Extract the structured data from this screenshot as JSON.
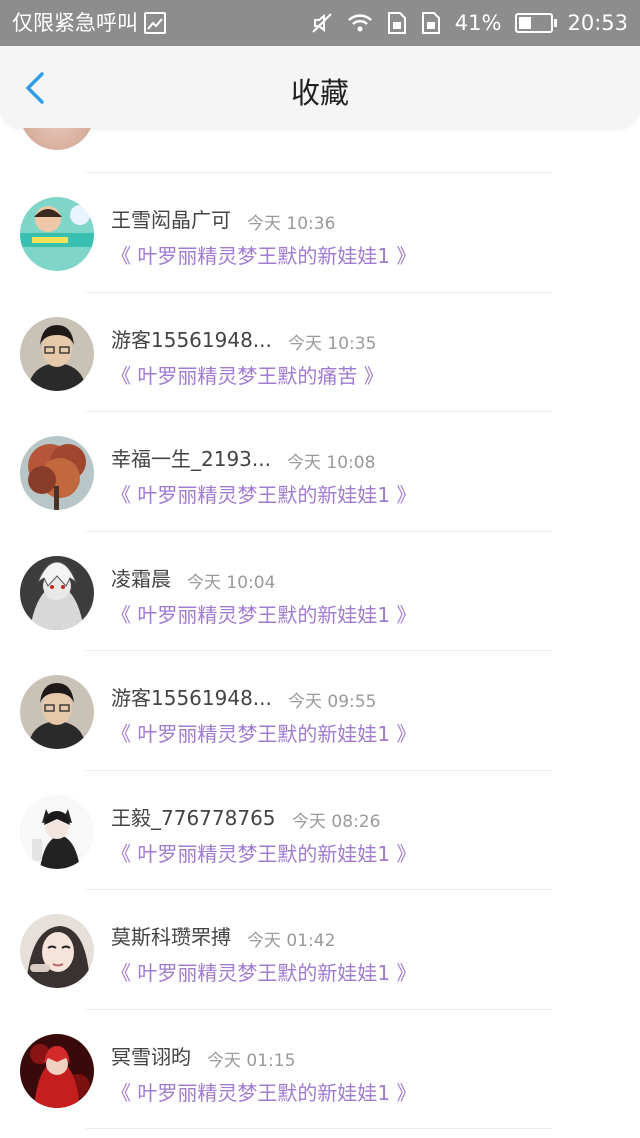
{
  "status_bar": {
    "carrier_text": "仅限紧急呼叫",
    "battery": "41%",
    "battery_level": 0.41,
    "time": "20:53",
    "icons": [
      "image-icon",
      "mute-icon",
      "wifi-icon",
      "sim1-icon",
      "sim2-icon",
      "battery-icon"
    ]
  },
  "header": {
    "title": "收藏",
    "back_icon": "chevron-left-icon",
    "accent": "#2f9ee6"
  },
  "colors": {
    "work_title": "#a07bd0",
    "time": "#9a9a9a",
    "name": "#444444"
  },
  "items": [
    {
      "name": "王雪闳晶广可",
      "time": "今天 10:36",
      "work": "《 叶罗丽精灵梦王默的新娃娃1 》",
      "avatar": "avatar-banner"
    },
    {
      "name": "游客15561948...",
      "time": "今天 10:35",
      "work": "《 叶罗丽精灵梦王默的痛苦 》",
      "avatar": "avatar-person"
    },
    {
      "name": "幸福一生_2193...",
      "time": "今天 10:08",
      "work": "《 叶罗丽精灵梦王默的新娃娃1 》",
      "avatar": "avatar-tree"
    },
    {
      "name": "凌霜晨",
      "time": "今天 10:04",
      "work": "《 叶罗丽精灵梦王默的新娃娃1 》",
      "avatar": "avatar-anime-gray"
    },
    {
      "name": "游客15561948...",
      "time": "今天 09:55",
      "work": "《 叶罗丽精灵梦王默的新娃娃1 》",
      "avatar": "avatar-person"
    },
    {
      "name": "王毅_776778765",
      "time": "今天 08:26",
      "work": "《 叶罗丽精灵梦王默的新娃娃1 》",
      "avatar": "avatar-anime-cat"
    },
    {
      "name": "莫斯科瓒罘搏",
      "time": "今天 01:42",
      "work": "《 叶罗丽精灵梦王默的新娃娃1 》",
      "avatar": "avatar-girl"
    },
    {
      "name": "冥雪诩昀",
      "time": "今天 01:15",
      "work": "《 叶罗丽精灵梦王默的新娃娃1 》",
      "avatar": "avatar-anime-red"
    }
  ]
}
